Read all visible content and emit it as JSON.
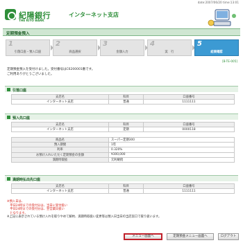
{
  "header": {
    "datetime": "date:2007/06/20 time:13:01",
    "bank_name": "紀陽銀行",
    "bank_en": "THE KIYO BANK",
    "branch": "インターネット支店"
  },
  "title": "定期預金預入",
  "steps": [
    {
      "num": "1",
      "label": "引落口座・預入口座"
    },
    {
      "num": "2",
      "label": "商品選択"
    },
    {
      "num": "3",
      "label": "金額入力"
    },
    {
      "num": "4",
      "label": "実　行"
    },
    {
      "num": "5",
      "label": "結果確認"
    }
  ],
  "page_code": "[B-TE-005]",
  "message": {
    "line1": "定期預金預入を受付けました。受付番号はC6200001番です。",
    "line2": "ご利用ありがとうございました。"
  },
  "withdraw": {
    "title": "引落口座",
    "headers": [
      "支店名",
      "科目",
      "口座番号"
    ],
    "row": [
      "インターネット支店",
      "普通",
      "1111111"
    ]
  },
  "deposit": {
    "title": "預入先口座",
    "headers": [
      "支店名",
      "科目",
      "口座番号"
    ],
    "row": [
      "インターネット支店",
      "定期",
      "0000118"
    ],
    "details": [
      {
        "label": "商品名",
        "value": "スーパー定期300"
      },
      {
        "label": "預入期間",
        "value": "1年"
      },
      {
        "label": "利率",
        "value": "0.320%"
      },
      {
        "label": "お預け入れいただく定期預金の金額",
        "value": "¥300,000"
      },
      {
        "label": "満期時取扱",
        "value": "元利継続"
      }
    ]
  },
  "maturity": {
    "title": "満期時払出先口座",
    "headers": [
      "支店名",
      "科目",
      "口座番号"
    ],
    "row": [
      "インターネット支店",
      "普通",
      "1111111"
    ]
  },
  "notes": {
    "n1": "※預入日は、",
    "n2": "　平日24時までの受付分は、当日に受付扱い",
    "n3": "　平日24時までの受付分は、翌営業日扱い",
    "n4": "　となります。",
    "n5": "※上記に表示されている預け入れを取りやめて解約、満期時取扱い変更等は預入日当日の当店窓口で取り扱います。"
  },
  "buttons": {
    "menu": "メニュー画面へ",
    "deposit_menu": "定期預金メニュー画面へ",
    "logout": "ログアウト"
  },
  "colors": {
    "brand_green": "#2f8f3a",
    "active_step": "#3c9ad3",
    "highlight_red": "#c0202a"
  }
}
